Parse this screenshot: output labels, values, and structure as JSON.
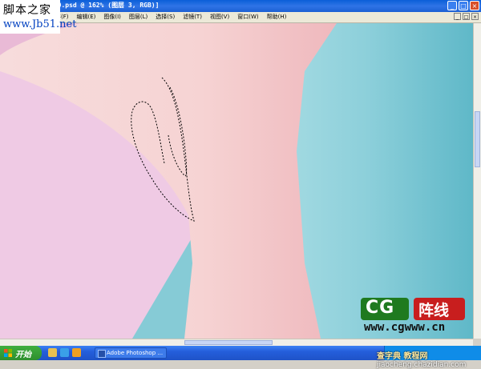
{
  "window": {
    "title": "[10.psd @ 162% (图层 3, RGB)]",
    "buttons": {
      "minimize": "_",
      "maximize": "□",
      "close": "×"
    }
  },
  "watermark_top": {
    "line1": "脚本之家",
    "line2": "www.Jb51.net"
  },
  "menu": {
    "items": [
      {
        "label": "文件(F)"
      },
      {
        "label": "编辑(E)"
      },
      {
        "label": "图像(I)"
      },
      {
        "label": "图层(L)"
      },
      {
        "label": "选择(S)"
      },
      {
        "label": "滤镜(T)"
      },
      {
        "label": "视图(V)"
      },
      {
        "label": "窗口(W)"
      },
      {
        "label": "帮助(H)"
      }
    ]
  },
  "canvas": {
    "colors": {
      "pink_bg": "#f0c8e2",
      "skin": "#f4cfcf",
      "teal": "#7ec8d4",
      "selection": "#000000"
    }
  },
  "taskbar": {
    "start_label": "开始",
    "task_label": "Adobe Photoshop ..."
  },
  "logo": {
    "cg": "CG",
    "zx": "阵线",
    "url": "www.cgwww.cn"
  },
  "watermark_bottom": {
    "cn": "查字典 教程网",
    "url": "jiaocheng.chazidian.com"
  }
}
